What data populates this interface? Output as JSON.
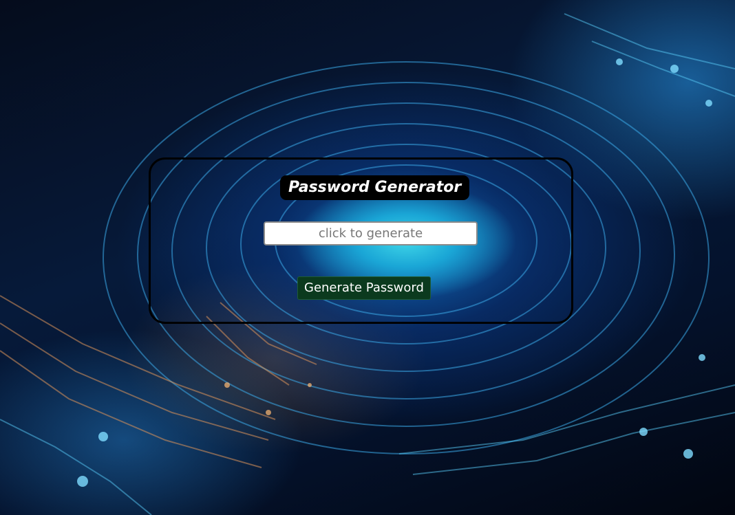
{
  "header": {
    "title": "Password Generator"
  },
  "password_field": {
    "placeholder": "click to generate",
    "value": ""
  },
  "actions": {
    "generate_label": "Generate Password"
  },
  "colors": {
    "button_background": "#0b3a1e",
    "title_background": "#000000",
    "card_border": "#000000"
  }
}
